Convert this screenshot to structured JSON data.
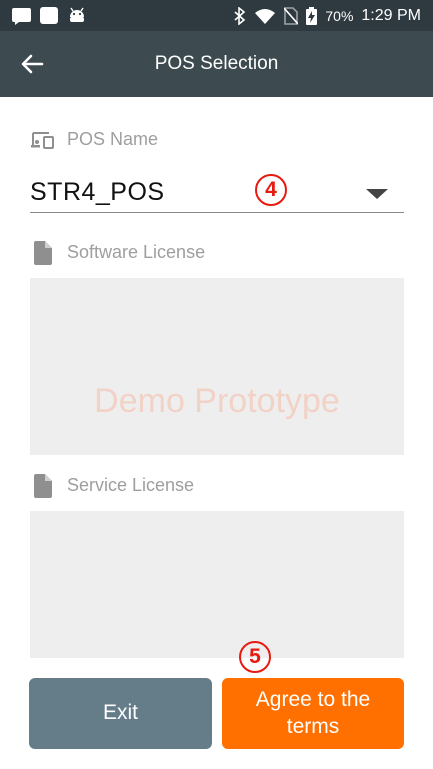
{
  "status_bar": {
    "battery": "70%",
    "time": "1:29 PM"
  },
  "app_bar": {
    "title": "POS Selection",
    "back_icon": "arrow-left-icon"
  },
  "pos_name": {
    "label": "POS Name",
    "icon": "devices-icon",
    "selected_value": "STR4_POS"
  },
  "software_license": {
    "label": "Software License",
    "icon": "document-icon",
    "watermark": "Demo Prototype"
  },
  "service_license": {
    "label": "Service License",
    "icon": "document-icon"
  },
  "markers": {
    "step_4": "4",
    "step_5": "5"
  },
  "buttons": {
    "exit_label": "Exit",
    "agree_label": "Agree to the terms"
  },
  "colors": {
    "status_bar": "#2e3a40",
    "app_bar": "#3d4a50",
    "exit_button": "#647d89",
    "agree_button": "#ff7000",
    "marker": "#e8190f"
  }
}
